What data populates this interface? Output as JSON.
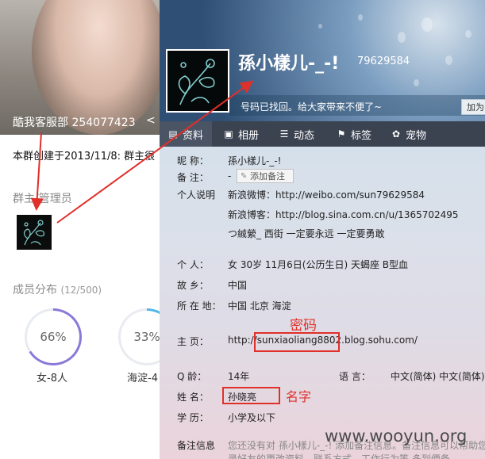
{
  "group_panel": {
    "name": "酷我客服部 254077423",
    "created": "本群创建于2013/11/8:  群主很",
    "admin_title": "群主/管理员",
    "members_title": "成员分布",
    "members_count": "(12/500)",
    "stats": [
      {
        "percent_text": "66%",
        "value": 66,
        "label": "女-8人",
        "color": "#8a78d8"
      },
      {
        "percent_text": "33%",
        "value": 33,
        "label": "海淀-4",
        "color": "#4fb6e8"
      }
    ]
  },
  "profile": {
    "nickname": "孫小樣儿-_-!",
    "qq": "79629584",
    "signature": "号码已找回。给大家带来不便了~",
    "add_button": "加为",
    "tabs": [
      {
        "label": "资料",
        "icon": "profile-icon",
        "active": true
      },
      {
        "label": "相册",
        "icon": "album-icon"
      },
      {
        "label": "动态",
        "icon": "feed-icon"
      },
      {
        "label": "标签",
        "icon": "tag-icon"
      },
      {
        "label": "宠物",
        "icon": "pet-icon"
      }
    ],
    "fields": {
      "nick_label": "昵    称：",
      "nick_value": "孫小樣儿-_-!",
      "remark_label": "备    注：",
      "remark_value": "-",
      "remark_button": "添加备注",
      "intro_label": "个人说明",
      "intro_lines": [
        "新浪微博：http://weibo.com/sun79629584",
        "新浪博客：http://blog.sina.com.cn/u/1365702495",
        "つ絾縈_  西街  一定要永远  一定要勇敢"
      ],
      "person_label": "个    人：",
      "person_value": "女   30岁   11月6日(公历生日)   天蝎座   B型血",
      "hometown_label": "故    乡：",
      "hometown_value": "中国",
      "location_label": "所 在 地：",
      "location_value": "中国 北京 海淀",
      "homepage_label": "主    页：",
      "homepage_value": "http://sunxiaoliang8802.blog.sohu.com/",
      "qage_label": "Q     龄：",
      "qage_value": "14年",
      "language_label": "语     言：",
      "language_value": "中文(简体)   中文(简体)",
      "name_label": "姓    名：",
      "name_value": "孙晓亮",
      "edu_label": "学    历：",
      "edu_value": "小学及以下",
      "note_label": "备注信息",
      "note_value": "您还没有对 孫小樣儿-_-! 添加备注信息。备注信息可以帮助您",
      "note_value2": "录好友的更改资料、联系方式、工作行为等    多到便备"
    }
  },
  "annotations": {
    "password": "密码",
    "realname": "名字"
  },
  "watermark": "www.wooyun.org"
}
